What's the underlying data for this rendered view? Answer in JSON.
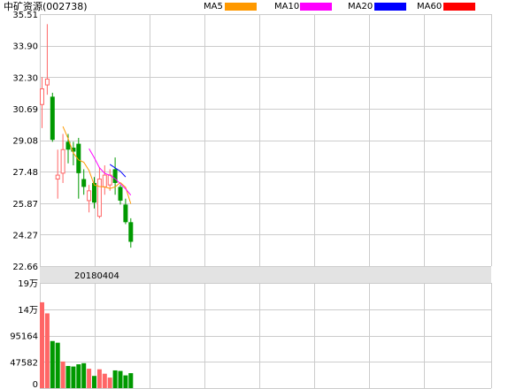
{
  "title": "中矿资源(002738)",
  "legend": [
    {
      "label": "MA5",
      "color": "#ff9900"
    },
    {
      "label": "MA10",
      "color": "#ff00ff"
    },
    {
      "label": "MA20",
      "color": "#0000ff"
    },
    {
      "label": "MA60",
      "color": "#ff0000"
    }
  ],
  "colors": {
    "up": "#ff6666",
    "down": "#009900",
    "grid": "#cccccc",
    "separator": "#e3e3e3"
  },
  "chart_data": [
    {
      "type": "candlestick",
      "ylim": [
        22.66,
        35.51
      ],
      "y_ticks": [
        "35.51",
        "33.90",
        "32.30",
        "30.69",
        "29.08",
        "27.48",
        "25.87",
        "24.27",
        "22.66"
      ],
      "x_label": "20180404",
      "candles": [
        {
          "o": 30.9,
          "c": 31.7,
          "h": 32.3,
          "l": 29.7
        },
        {
          "o": 31.9,
          "c": 32.2,
          "h": 35.0,
          "l": 31.4
        },
        {
          "o": 31.3,
          "c": 29.1,
          "h": 31.5,
          "l": 29.0
        },
        {
          "o": 27.1,
          "c": 27.3,
          "h": 28.6,
          "l": 26.1
        },
        {
          "o": 27.4,
          "c": 28.6,
          "h": 29.4,
          "l": 26.9
        },
        {
          "o": 29.0,
          "c": 28.6,
          "h": 29.4,
          "l": 27.9
        },
        {
          "o": 28.7,
          "c": 28.5,
          "h": 29.0,
          "l": 27.8
        },
        {
          "o": 28.9,
          "c": 27.4,
          "h": 29.2,
          "l": 26.1
        },
        {
          "o": 27.1,
          "c": 26.7,
          "h": 27.6,
          "l": 26.3
        },
        {
          "o": 26.0,
          "c": 26.5,
          "h": 26.8,
          "l": 25.4
        },
        {
          "o": 26.9,
          "c": 25.9,
          "h": 27.2,
          "l": 25.6
        },
        {
          "o": 25.2,
          "c": 27.1,
          "h": 27.7,
          "l": 25.1
        },
        {
          "o": 26.7,
          "c": 27.3,
          "h": 27.8,
          "l": 26.3
        },
        {
          "o": 26.8,
          "c": 27.3,
          "h": 27.6,
          "l": 26.5
        },
        {
          "o": 27.6,
          "c": 26.9,
          "h": 28.2,
          "l": 26.3
        },
        {
          "o": 26.7,
          "c": 26.0,
          "h": 26.8,
          "l": 25.8
        },
        {
          "o": 25.8,
          "c": 24.9,
          "h": 26.1,
          "l": 24.8
        },
        {
          "o": 24.9,
          "c": 23.9,
          "h": 25.1,
          "l": 23.6
        }
      ],
      "ma5": [
        null,
        null,
        null,
        null,
        29.78,
        29.16,
        28.42,
        28.08,
        27.96,
        27.54,
        26.8,
        26.72,
        26.7,
        26.62,
        26.7,
        26.92,
        26.68,
        25.84
      ],
      "ma10": [
        null,
        null,
        null,
        null,
        null,
        null,
        null,
        null,
        null,
        28.65,
        28.19,
        27.68,
        27.39,
        27.29,
        27.12,
        26.86,
        26.6,
        26.28
      ],
      "ma20": [
        null,
        null,
        null,
        null,
        null,
        null,
        null,
        null,
        null,
        null,
        null,
        null,
        null,
        27.85,
        27.67,
        27.5,
        27.21,
        null
      ]
    },
    {
      "type": "bar",
      "ylim": [
        0,
        190000
      ],
      "y_ticks": [
        "19万",
        "14万",
        "95164",
        "47582",
        "0"
      ],
      "values": [
        155000,
        135000,
        85000,
        82000,
        48000,
        40000,
        39000,
        43000,
        45000,
        35000,
        22000,
        34000,
        26000,
        19000,
        32000,
        31000,
        23000,
        27000
      ],
      "up": [
        true,
        true,
        false,
        false,
        true,
        false,
        false,
        false,
        false,
        true,
        false,
        true,
        true,
        true,
        false,
        false,
        false,
        false
      ]
    }
  ]
}
